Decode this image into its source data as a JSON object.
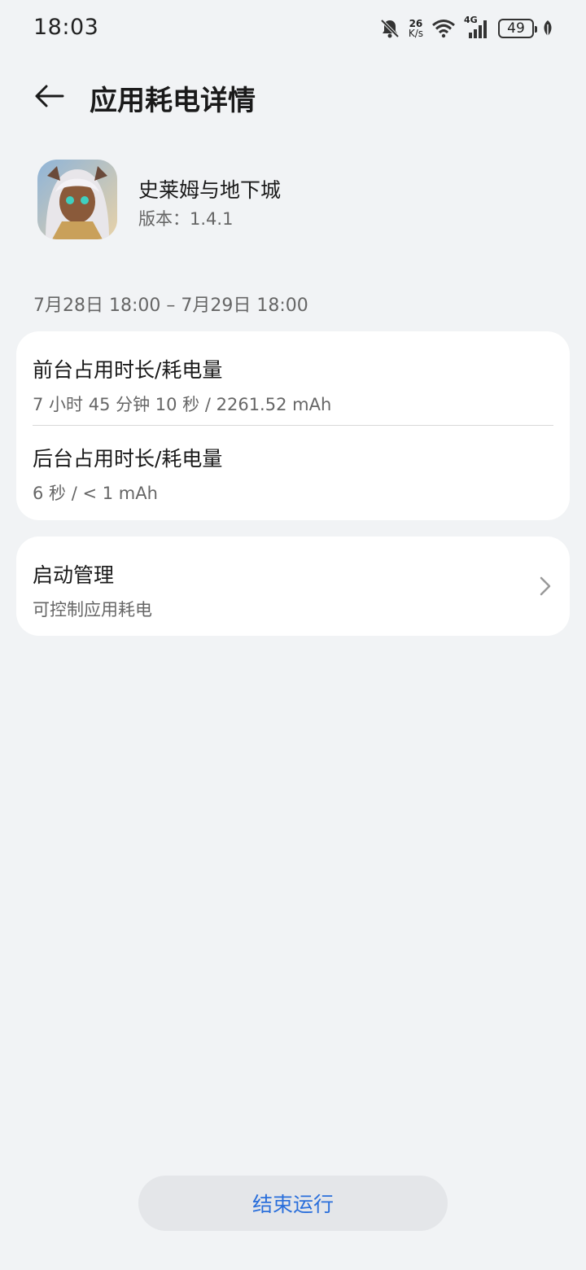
{
  "status_bar": {
    "time": "18:03",
    "net_speed_value": "26",
    "net_speed_unit": "K/s",
    "network_type": "4G",
    "battery_level": "49",
    "icons": [
      "bell-mute-icon",
      "wifi-icon",
      "signal-icon",
      "battery-icon",
      "leaf-icon"
    ]
  },
  "header": {
    "title": "应用耗电详情",
    "back_icon": "back-arrow-icon"
  },
  "app": {
    "name": "史莱姆与地下城",
    "version": "版本：1.4.1"
  },
  "date_range": "7月28日 18:00 – 7月29日 18:00",
  "usage": {
    "foreground": {
      "title": "前台占用时长/耗电量",
      "value": "7 小时 45 分钟 10 秒 / 2261.52 mAh"
    },
    "background": {
      "title": "后台占用时长/耗电量",
      "value": "6 秒 / < 1 mAh"
    }
  },
  "launch_management": {
    "title": "启动管理",
    "subtitle": "可控制应用耗电",
    "icon": "chevron-right-icon"
  },
  "end_button": "结束运行",
  "colors": {
    "background": "#f1f3f5",
    "card": "#ffffff",
    "accent": "#2a6fdb",
    "secondary_text": "#666666"
  }
}
